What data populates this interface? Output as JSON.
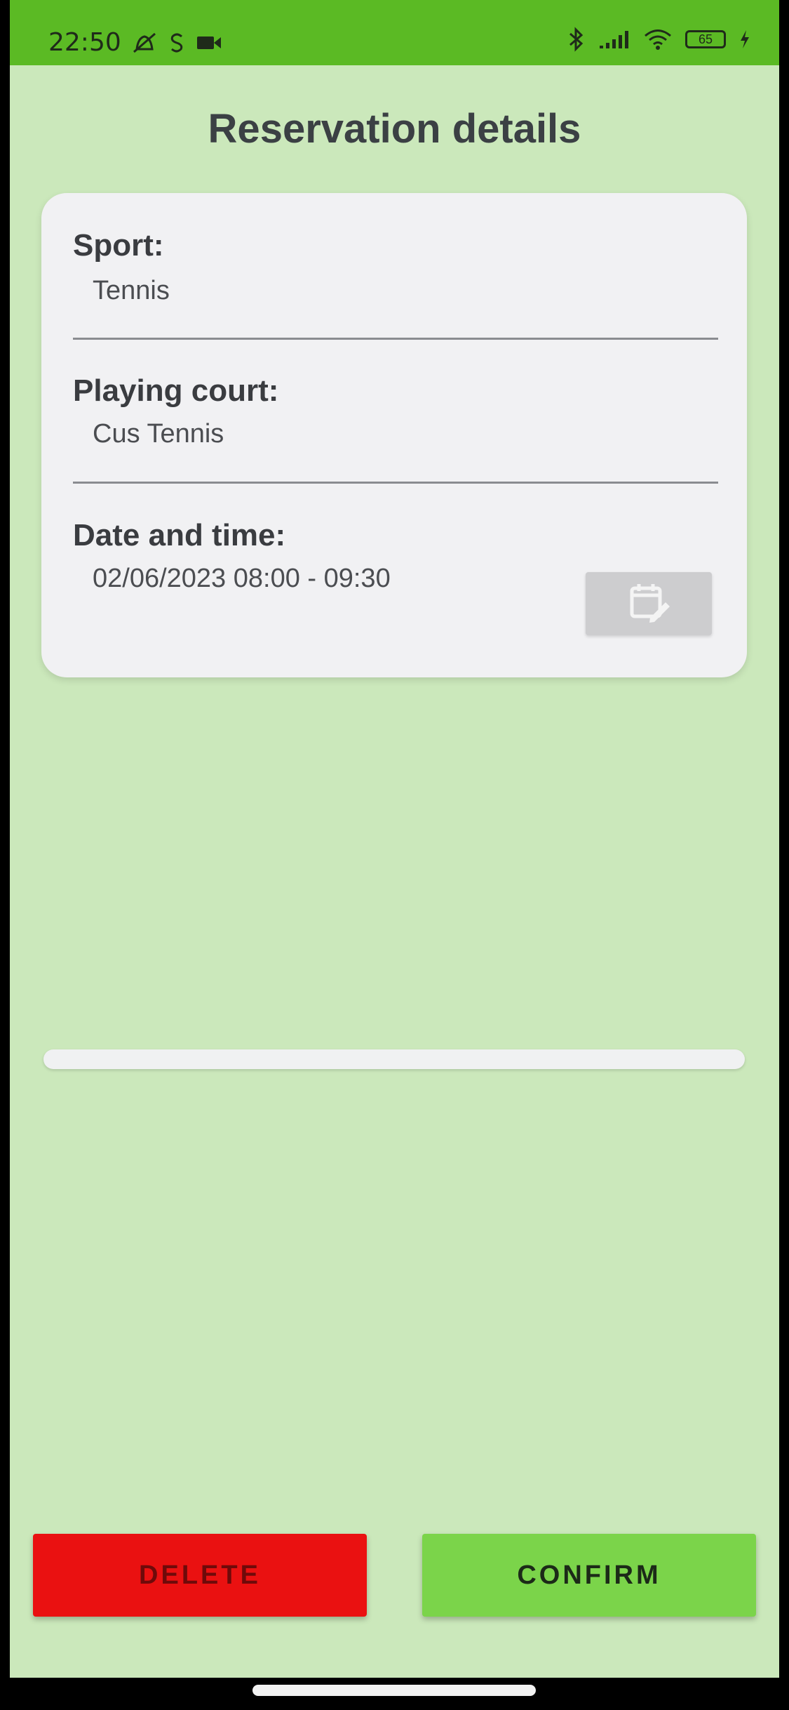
{
  "status_bar": {
    "time": "22:50",
    "battery": "65",
    "icons": [
      "mute-icon",
      "s-icon",
      "video-icon",
      "bluetooth-icon",
      "signal-icon",
      "wifi-icon",
      "battery-icon",
      "charging-icon"
    ]
  },
  "page": {
    "title": "Reservation details"
  },
  "details": {
    "sport_label": "Sport:",
    "sport_value": "Tennis",
    "court_label": "Playing court:",
    "court_value": "Cus Tennis",
    "datetime_label": "Date and time:",
    "datetime_value": "02/06/2023 08:00 - 09:30",
    "edit_icon": "calendar-edit-icon"
  },
  "progress": {
    "value": 0
  },
  "actions": {
    "delete_label": "DELETE",
    "confirm_label": "CONFIRM"
  },
  "colors": {
    "status_bar": "#5bba24",
    "background": "#cbe8bb",
    "delete": "#ea1111",
    "confirm": "#7bd44a"
  }
}
